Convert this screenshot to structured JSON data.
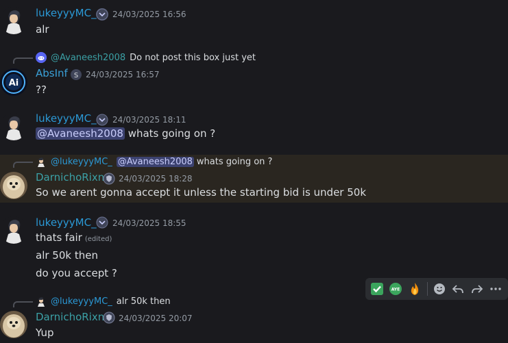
{
  "colors": {
    "luke_name": "#2b99d6",
    "absinf_name": "#3aa0d8",
    "darnicho_name": "#3ba0a5",
    "timestamp": "#949ba4",
    "mention_bg": "#3c4270",
    "highlight_bg": "#2a2620"
  },
  "messages": [
    {
      "username": "lukeyyyMC_",
      "timestamp": "24/03/2025 16:56",
      "lines": [
        "alr"
      ]
    },
    {
      "reply": {
        "username": "@Avaneesh2008",
        "text": "Do not post this box just yet"
      },
      "username": "AbsInf",
      "badge": "S",
      "timestamp": "24/03/2025 16:57",
      "lines": [
        "??"
      ]
    },
    {
      "username": "lukeyyyMC_",
      "timestamp": "24/03/2025 18:11",
      "mention": "@Avaneesh2008",
      "text": "whats going on ?"
    },
    {
      "reply": {
        "username": "@lukeyyyMC_",
        "mention": "@Avaneesh2008",
        "text": "whats going on ?"
      },
      "username": "DarnichoRixn",
      "timestamp": "24/03/2025 18:28",
      "lines": [
        "So we arent gonna accept it unless the starting bid is under 50k"
      ]
    },
    {
      "username": "lukeyyyMC_",
      "timestamp": "24/03/2025 18:55",
      "lines": [
        "thats fair",
        "alr 50k then",
        "do you accept ?"
      ],
      "edited": "(edited)"
    },
    {
      "reply": {
        "username": "@lukeyyyMC_",
        "text": "alr 50k then"
      },
      "username": "DarnichoRixn",
      "timestamp": "24/03/2025 20:07",
      "lines": [
        "Yup"
      ]
    }
  ],
  "toolbar": {
    "reactions": [
      "check-mark-emoji",
      "aye-emoji",
      "fire-emoji"
    ],
    "aye_label": "AYE",
    "actions": [
      "add-reaction-icon",
      "reply-icon",
      "forward-icon",
      "more-icon"
    ]
  }
}
